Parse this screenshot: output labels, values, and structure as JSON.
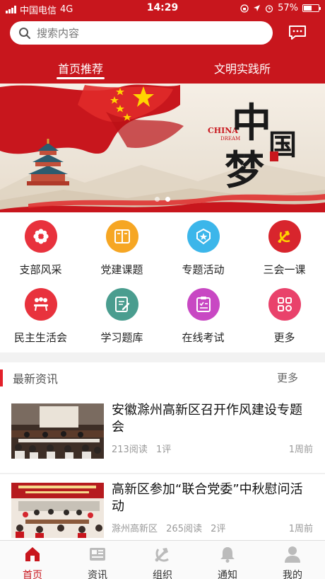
{
  "status": {
    "carrier": "中国电信",
    "network": "4G",
    "time": "14:29",
    "battery": "57%",
    "battery_level": 0.57
  },
  "search": {
    "placeholder": "搜索内容"
  },
  "tabs": {
    "recommend": "首页推荐",
    "practice": "文明实践所"
  },
  "banner": {
    "china": "CHINA",
    "dream": "DREAM",
    "char1": "中",
    "char2": "国",
    "char3": "梦",
    "slide_count": 2,
    "active_slide": 2
  },
  "grid": {
    "items": [
      {
        "label": "支部风采",
        "color": "#e8323d",
        "icon": "flower-icon"
      },
      {
        "label": "党建课题",
        "color": "#f6a623",
        "icon": "book-icon"
      },
      {
        "label": "专题活动",
        "color": "#3cb6ea",
        "icon": "badge-star-icon"
      },
      {
        "label": "三会一课",
        "color": "#d8252d",
        "icon": "party-emblem-icon"
      },
      {
        "label": "民主生活会",
        "color": "#e8323d",
        "icon": "meeting-icon"
      },
      {
        "label": "学习题库",
        "color": "#4a9d8f",
        "icon": "edit-doc-icon"
      },
      {
        "label": "在线考试",
        "color": "#c848c3",
        "icon": "checklist-icon"
      },
      {
        "label": "更多",
        "color": "#e9426b",
        "icon": "more-grid-icon"
      }
    ]
  },
  "news": {
    "header": "最新资讯",
    "more": "更多",
    "items": [
      {
        "title": "安徽滁州高新区召开作风建设专题会",
        "source": "",
        "reads": "213阅读",
        "comments": "1评",
        "time": "1周前"
      },
      {
        "title": "高新区参加“联合党委”中秋慰问活动",
        "source": "滁州高新区",
        "reads": "265阅读",
        "comments": "2评",
        "time": "1周前"
      }
    ]
  },
  "tabbar": {
    "home": "首页",
    "news": "资讯",
    "org": "组织",
    "notice": "通知",
    "mine": "我的"
  },
  "colors": {
    "brand_red": "#c8161d",
    "accent": "#e3202a"
  }
}
